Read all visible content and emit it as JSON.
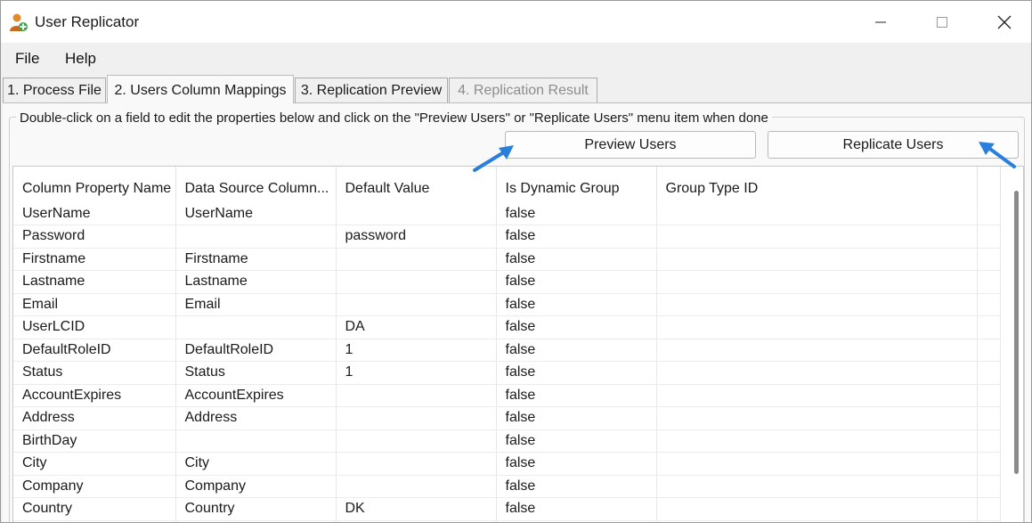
{
  "window": {
    "title": "User Replicator",
    "accent_color": "#2a7fdc"
  },
  "menu": {
    "file": "File",
    "help": "Help"
  },
  "tabs": [
    {
      "label": "1. Process File",
      "state": "normal"
    },
    {
      "label": "2. Users Column Mappings",
      "state": "active"
    },
    {
      "label": "3. Replication Preview",
      "state": "normal"
    },
    {
      "label": "4. Replication Result",
      "state": "disabled"
    }
  ],
  "panel": {
    "instructions": "Double-click on a field to edit the properties below and click on the \"Preview Users\" or \"Replicate Users\" menu item when done",
    "preview_button": "Preview Users",
    "replicate_button": "Replicate Users"
  },
  "grid": {
    "columns": [
      "Column Property Name",
      "Data Source Column...",
      "Default Value",
      "Is Dynamic Group",
      "Group Type ID"
    ],
    "rows": [
      [
        "UserName",
        "UserName",
        "",
        "false",
        ""
      ],
      [
        "Password",
        "",
        "password",
        "false",
        ""
      ],
      [
        "Firstname",
        "Firstname",
        "",
        "false",
        ""
      ],
      [
        "Lastname",
        "Lastname",
        "",
        "false",
        ""
      ],
      [
        "Email",
        "Email",
        "",
        "false",
        ""
      ],
      [
        "UserLCID",
        "",
        "DA",
        "false",
        ""
      ],
      [
        "DefaultRoleID",
        "DefaultRoleID",
        "1",
        "false",
        ""
      ],
      [
        "Status",
        "Status",
        "1",
        "false",
        ""
      ],
      [
        "AccountExpires",
        "AccountExpires",
        "",
        "false",
        ""
      ],
      [
        "Address",
        "Address",
        "",
        "false",
        ""
      ],
      [
        "BirthDay",
        "",
        "",
        "false",
        ""
      ],
      [
        "City",
        "City",
        "",
        "false",
        ""
      ],
      [
        "Company",
        "Company",
        "",
        "false",
        ""
      ],
      [
        "Country",
        "Country",
        "DK",
        "false",
        ""
      ],
      [
        "",
        "",
        "",
        "false",
        ""
      ]
    ]
  }
}
